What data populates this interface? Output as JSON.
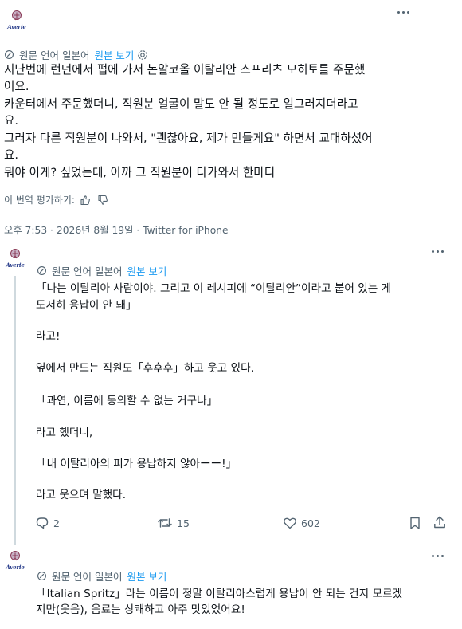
{
  "main_tweet": {
    "avatar_brand": "Averie",
    "translation_bar": {
      "text": "원문 언어 일본어",
      "show_original": "원본 보기"
    },
    "body_lines": [
      "지난번에 런던에서 펍에 가서 논알코올 이탈리안 스프리츠 모히토를 주문했",
      "어요.",
      "카운터에서 주문했더니, 직원분 얼굴이 말도 안 될 정도로 일그러지더라고",
      "요.",
      "그러자 다른 직원분이 나와서, \"괜찮아요, 제가 만들게요\" 하면서 교대하셨어",
      "요.",
      "뭐야 이게? 싶었는데, 아까 그 직원분이 다가와서 한마디"
    ],
    "rate_translation": "이 번역 평가하기:",
    "timestamp": "오후 7:53 · 2026년 8월 19일 · Twitter for iPhone"
  },
  "reply_1": {
    "avatar_brand": "Averie",
    "translation_bar": {
      "text": "원문 언어 일본어",
      "show_original": "원본 보기"
    },
    "body_lines": [
      "「나는 이탈리아 사람이야. 그리고 이 레시피에 “이탈리안”이라고 붙어 있는 게",
      "도저히 용납이 안 돼」",
      "라고!",
      "옆에서 만드는 직원도「후후후」하고 웃고 있다.",
      "「과연, 이름에 동의할 수 없는 거구나」",
      "라고 했더니,",
      "「내 이탈리아의 피가 용납하지 않아ーー!」",
      "라고 웃으며 말했다."
    ],
    "actions": {
      "replies": "2",
      "retweets": "15",
      "likes": "602"
    }
  },
  "reply_2": {
    "avatar_brand": "Averie",
    "translation_bar": {
      "text": "원문 언어 일본어",
      "show_original": "원본 보기"
    },
    "body_lines": [
      "「Italian Spritz」라는 이름이 정말 이탈리아스럽게 용납이 안 되는 건지 모르겠",
      "지만(웃음), 음료는 상쾌하고 아주 맛있었어요!"
    ]
  },
  "colors": {
    "text": "#0f1419",
    "secondary": "#536471",
    "link": "#1d9bf0",
    "divider": "#eff3f4",
    "thread_line": "#cfd9de",
    "brand": "#2b3f8c"
  },
  "icons": [
    "translate-icon",
    "settings-icon",
    "thumbs-up-icon",
    "thumbs-down-icon",
    "more-icon",
    "reply-icon",
    "retweet-icon",
    "like-icon",
    "bookmark-icon",
    "share-icon"
  ]
}
